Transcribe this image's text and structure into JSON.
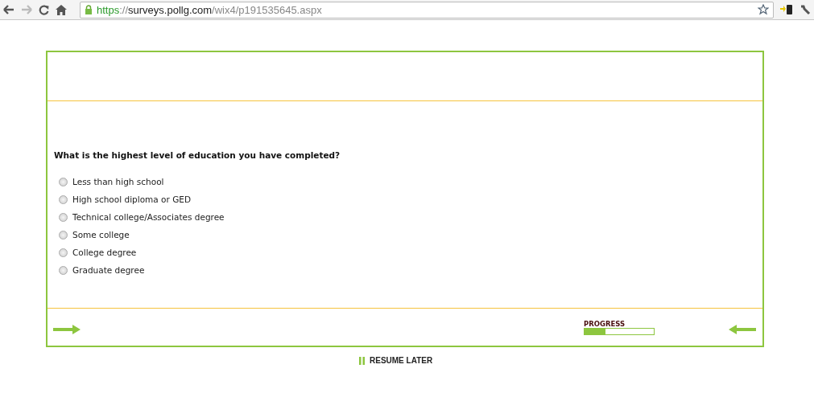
{
  "browser": {
    "url": {
      "scheme": "https",
      "separator": "://",
      "host": "surveys.pollg.com",
      "path": "/wix4/p191535645.aspx"
    }
  },
  "survey": {
    "question": "What is the highest level of education you have completed?",
    "options": [
      {
        "label": "Less than high school",
        "selected": false
      },
      {
        "label": "High school diploma or GED",
        "selected": false
      },
      {
        "label": "Technical college/Associates degree",
        "selected": false
      },
      {
        "label": "Some college",
        "selected": false
      },
      {
        "label": "College degree",
        "selected": false
      },
      {
        "label": "Graduate degree",
        "selected": false
      }
    ],
    "progress": {
      "label": "PROGRESS",
      "level": 0.3
    },
    "resume": "RESUME LATER"
  }
}
